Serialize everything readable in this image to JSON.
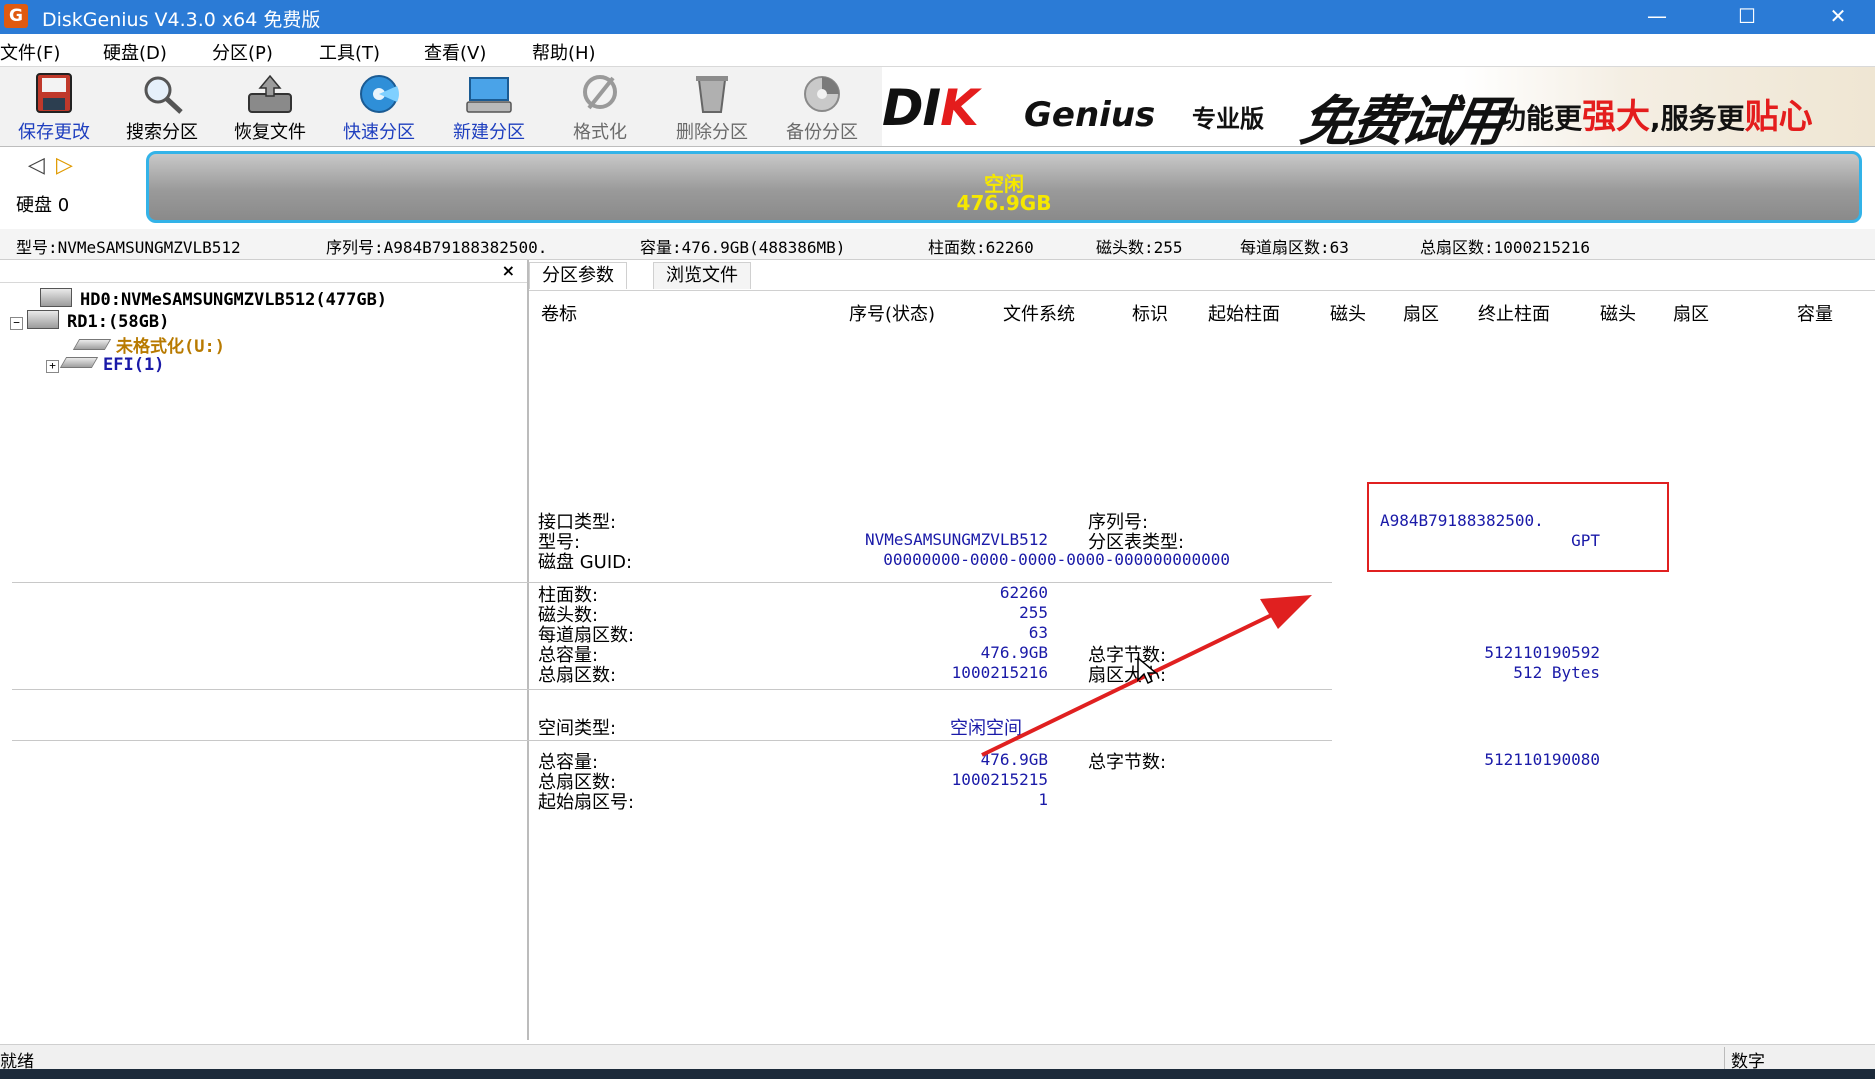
{
  "window": {
    "title": "DiskGenius V4.3.0 x64 免费版",
    "app_icon_glyph": "G",
    "minimize_glyph": "—",
    "maximize_glyph": "☐",
    "close_glyph": "✕"
  },
  "menu": [
    "文件(F)",
    "硬盘(D)",
    "分区(P)",
    "工具(T)",
    "查看(V)",
    "帮助(H)"
  ],
  "toolbar": [
    {
      "label": "保存更改",
      "icon": "save-disk-icon",
      "state": "enabled"
    },
    {
      "label": "搜索分区",
      "icon": "magnifier-icon",
      "state": "normal"
    },
    {
      "label": "恢复文件",
      "icon": "recover-file-icon",
      "state": "normal"
    },
    {
      "label": "快速分区",
      "icon": "quick-partition-icon",
      "state": "enabled"
    },
    {
      "label": "新建分区",
      "icon": "new-partition-icon",
      "state": "enabled"
    },
    {
      "label": "格式化",
      "icon": "format-icon",
      "state": "disabled"
    },
    {
      "label": "删除分区",
      "icon": "delete-partition-icon",
      "state": "disabled"
    },
    {
      "label": "备份分区",
      "icon": "backup-partition-icon",
      "state": "disabled"
    }
  ],
  "banner": {
    "logo_a": "DI",
    "logo_b": "K",
    "logo_c": "Genius",
    "edition": "专业版",
    "free_trial": "免费试用",
    "slogan_1": "功能更",
    "slogan_2": "强大",
    "slogan_3": ",服务更",
    "slogan_4": "贴心"
  },
  "disk_strip": {
    "prev_glyph": "◁",
    "next_glyph": "▷",
    "disk_label": "硬盘 0",
    "bar_line1": "空闲",
    "bar_line2": "476.9GB"
  },
  "disk_info": {
    "model": "型号:NVMeSAMSUNGMZVLB512",
    "serial": "序列号:A984B79188382500.",
    "capacity": "容量:476.9GB(488386MB)",
    "cylinders": "柱面数:62260",
    "heads": "磁头数:255",
    "sectors_per_track": "每道扇区数:63",
    "total_sectors": "总扇区数:1000215216"
  },
  "tree": {
    "close_glyph": "×",
    "items": [
      {
        "label": "HD0:NVMeSAMSUNGMZVLB512(477GB)",
        "color": "#000000"
      },
      {
        "label": "RD1:(58GB)",
        "color": "#000000",
        "expander": "−"
      },
      {
        "label": "未格式化(U:)",
        "color": "#b87a00"
      },
      {
        "label": "EFI(1)",
        "color": "#1a1aa8",
        "expander": "+"
      }
    ]
  },
  "tabs": [
    "分区参数",
    "浏览文件"
  ],
  "columns": [
    "卷标",
    "序号(状态)",
    "文件系统",
    "标识",
    "起始柱面",
    "磁头",
    "扇区",
    "终止柱面",
    "磁头",
    "扇区",
    "容量"
  ],
  "details": {
    "interface_label": "接口类型:",
    "model_label": "型号:",
    "model_value": "NVMeSAMSUNGMZVLB512",
    "guid_label": "磁盘 GUID:",
    "guid_value": "00000000-0000-0000-0000-000000000000",
    "serial_label": "序列号:",
    "serial_value": "A984B79188382500.",
    "table_type_label": "分区表类型:",
    "table_type_value": "GPT",
    "cylinders_label": "柱面数:",
    "cylinders_value": "62260",
    "heads_label": "磁头数:",
    "heads_value": "255",
    "spt_label": "每道扇区数:",
    "spt_value": "63",
    "capacity_label": "总容量:",
    "capacity_value": "476.9GB",
    "total_bytes_label": "总字节数:",
    "total_bytes_value": "512110190592",
    "total_sectors_label": "总扇区数:",
    "total_sectors_value": "1000215216",
    "sector_size_label": "扇区大小:",
    "sector_size_value": "512 Bytes",
    "space_type_label": "空间类型:",
    "space_type_value": "空闲空间",
    "free_capacity_label": "总容量:",
    "free_capacity_value": "476.9GB",
    "free_bytes_label": "总字节数:",
    "free_bytes_value": "512110190080",
    "free_sectors_label": "总扇区数:",
    "free_sectors_value": "1000215215",
    "start_sector_label": "起始扇区号:",
    "start_sector_value": "1"
  },
  "status": {
    "left": "就绪",
    "right": "数字"
  },
  "colors": {
    "titlebar": "#2b7bd6",
    "value_blue": "#1a1aa8",
    "annotation_red": "#e02020",
    "bar_text_yellow": "#f6e800",
    "disk_bar_border": "#33b3e8"
  }
}
